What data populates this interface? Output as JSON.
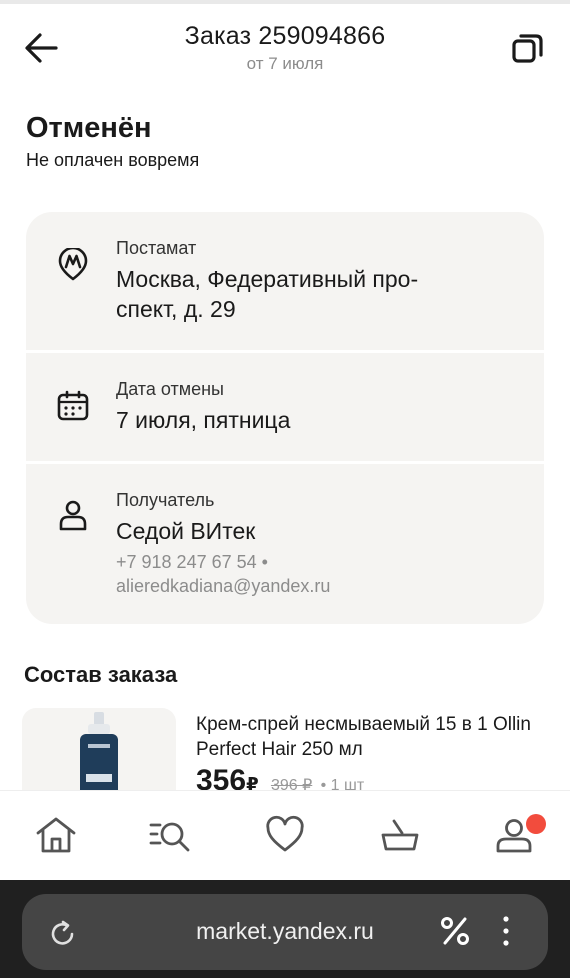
{
  "header": {
    "title": "Заказ 259094866",
    "subtitle": "от 7 июля",
    "back_icon": "arrow-left-icon",
    "copy_icon": "copy-icon"
  },
  "status": {
    "title": "Отменён",
    "reason": "Не оплачен вовремя"
  },
  "details": {
    "pickup": {
      "label": "Постамат",
      "address_line1": "Москва, Федеративный про-",
      "address_line2": "спект, д. 29",
      "icon": "metro-pin-icon"
    },
    "cancel": {
      "label": "Дата отмены",
      "value": "7 июля, пятница",
      "icon": "calendar-icon"
    },
    "recipient": {
      "label": "Получатель",
      "name": "Седой ВИтек",
      "phone": "+7 918 247 67 54 •",
      "email": "alieredkadiana@yandex.ru",
      "icon": "person-icon"
    }
  },
  "order": {
    "section_title": "Состав заказа",
    "items": [
      {
        "name": "Крем-спрей несмываемый 15 в 1 Ollin Perfect Hair 250 мл",
        "price": "356",
        "currency": "₽",
        "old_price": "396 ₽",
        "quantity": "• 1 шт"
      }
    ]
  },
  "tabbar": {
    "items": [
      "home-icon",
      "catalog-search-icon",
      "heart-icon",
      "cart-icon",
      "profile-icon"
    ],
    "badge_color": "#f24c3d"
  },
  "browser": {
    "url": "market.yandex.ru",
    "reload_icon": "reload-icon",
    "discount_icon": "percent-icon",
    "menu_icon": "more-vertical-icon"
  },
  "colors": {
    "card_bg": "#f5f4f2",
    "muted_text": "#8c8c8c",
    "browser_bg": "#202020",
    "urlbar_bg": "#454545"
  }
}
